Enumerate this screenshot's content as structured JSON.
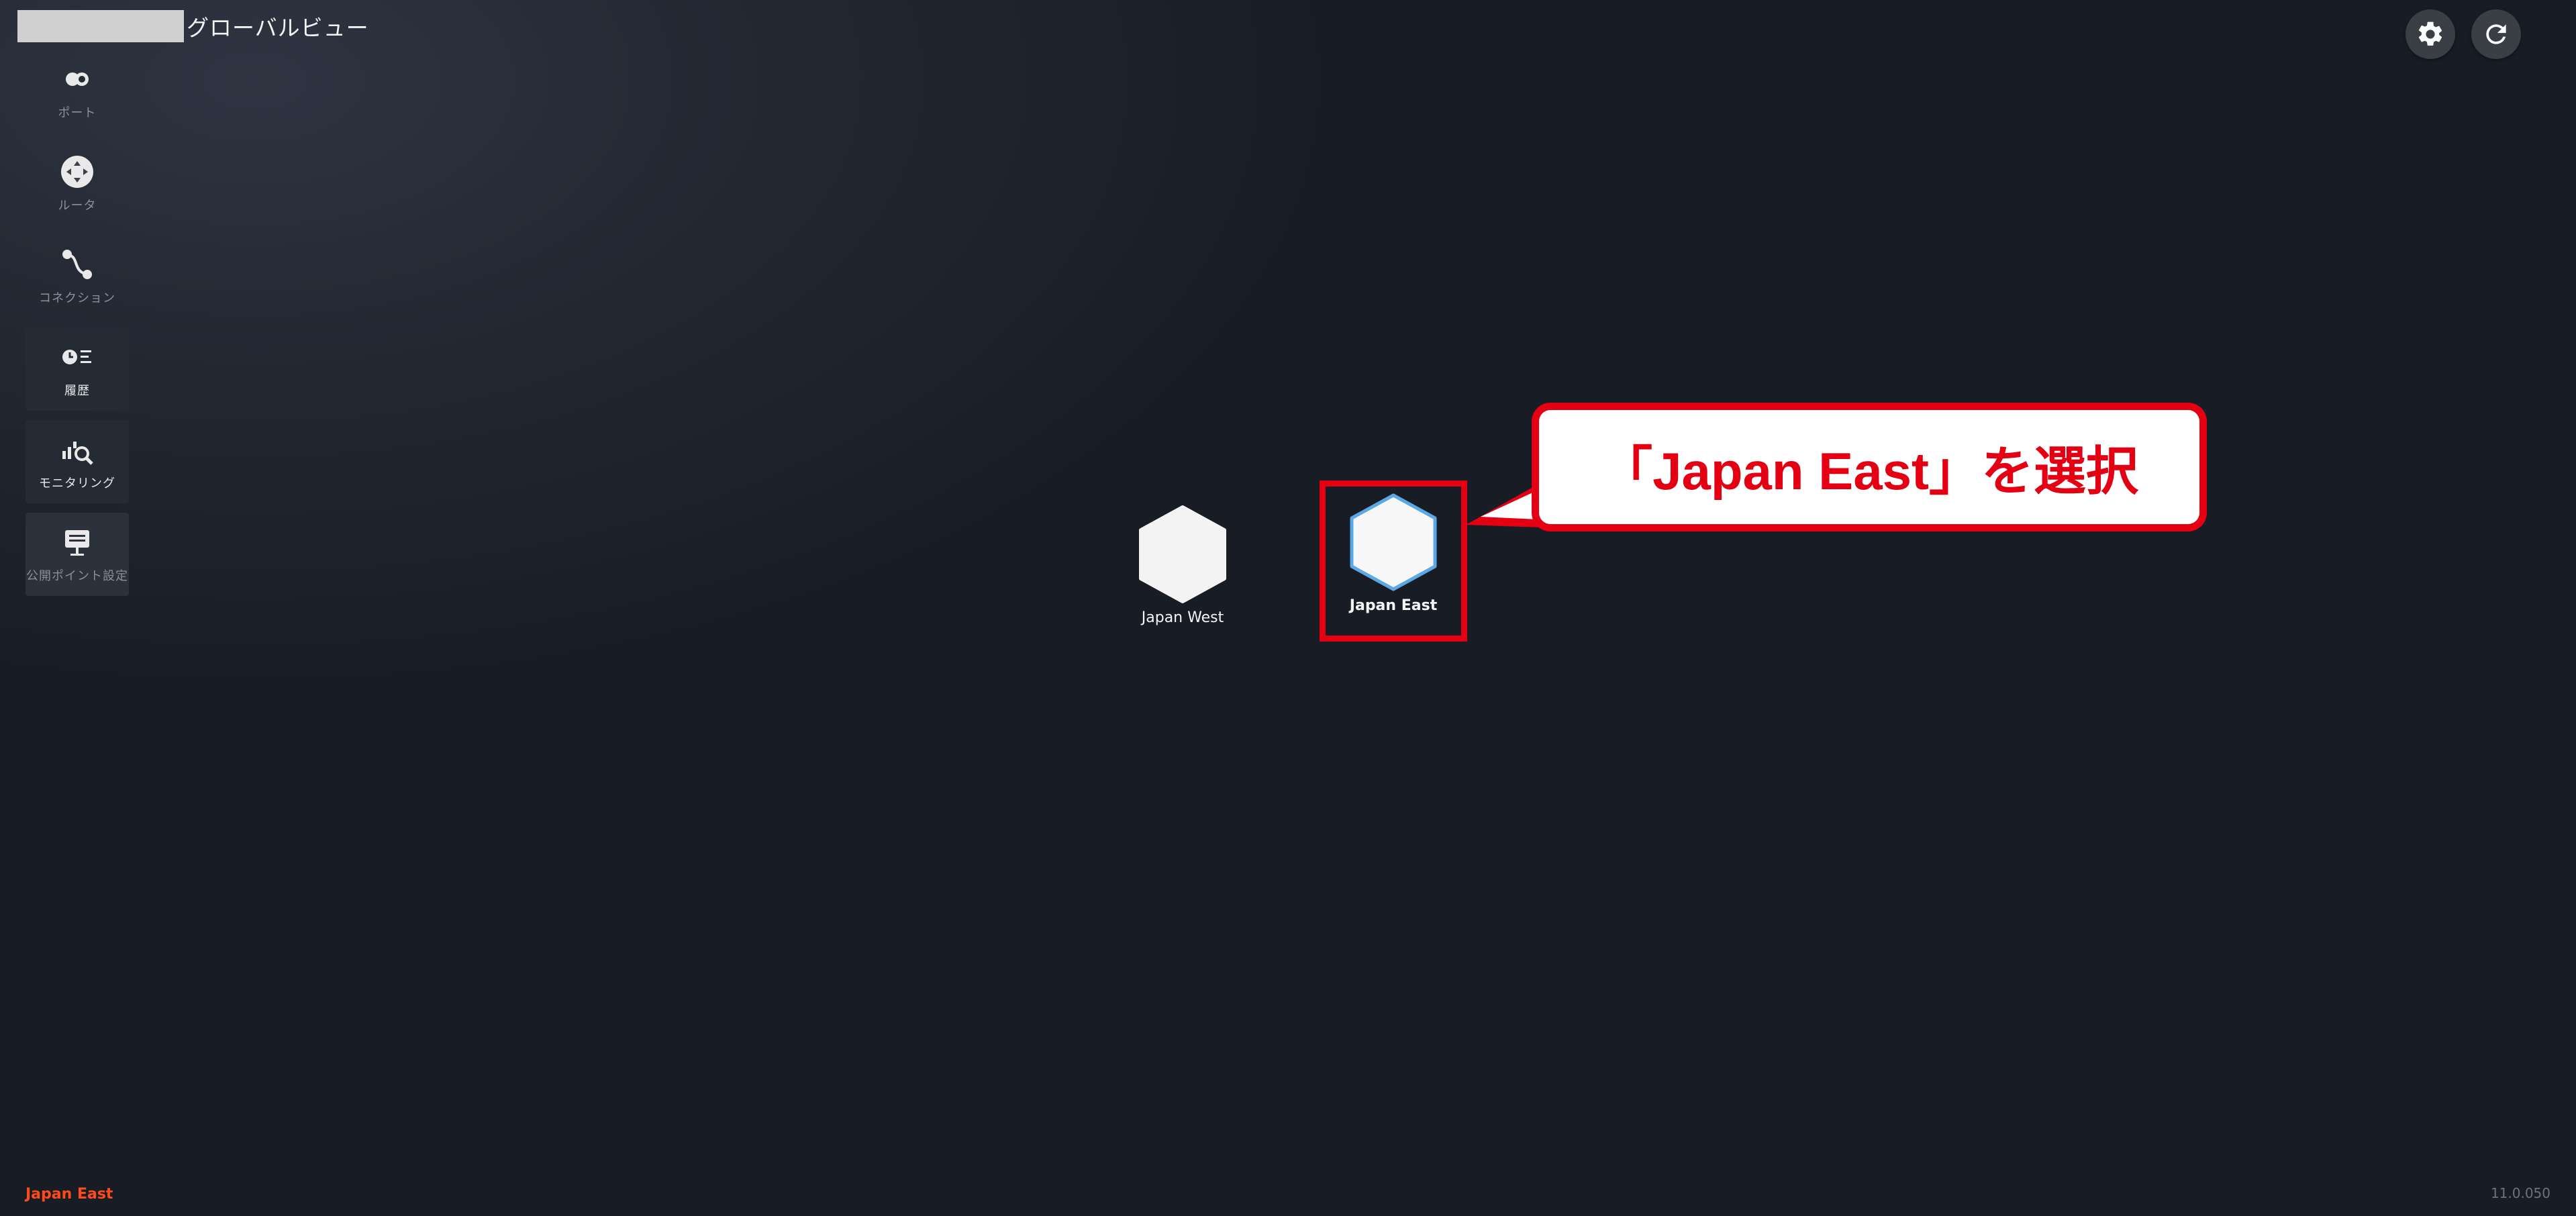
{
  "header": {
    "app_title": "グローバルビュー"
  },
  "top_actions": {
    "settings_icon": "gear-icon",
    "refresh_icon": "refresh-icon"
  },
  "sidebar": {
    "items": [
      {
        "label": "ポート",
        "icon": "port-icon"
      },
      {
        "label": "ルータ",
        "icon": "router-icon"
      },
      {
        "label": "コネクション",
        "icon": "connection-icon"
      },
      {
        "label": "履歴",
        "icon": "history-icon"
      },
      {
        "label": "モニタリング",
        "icon": "monitoring-icon"
      },
      {
        "label": "公開ポイント設定",
        "icon": "public-point-icon"
      }
    ]
  },
  "regions": [
    {
      "label": "Japan West",
      "selected": false
    },
    {
      "label": "Japan East",
      "selected": true
    }
  ],
  "annotation": {
    "text": "「Japan East」を選択",
    "color": "#e40012"
  },
  "footer": {
    "region": "Japan East",
    "version": "11.0.050"
  }
}
